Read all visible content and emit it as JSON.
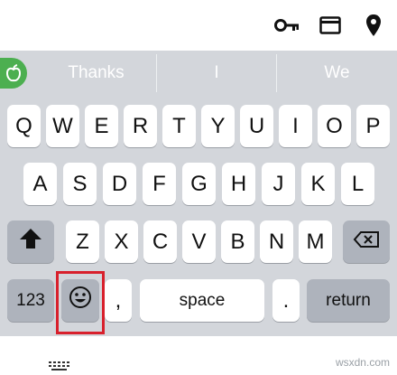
{
  "toolbar": {
    "icons": [
      "key-icon",
      "card-icon",
      "location-pin-icon"
    ]
  },
  "suggestions": {
    "logo_icon": "apple-logo-icon",
    "items": [
      "Thanks",
      "I",
      "We"
    ]
  },
  "keyboard": {
    "row1": [
      "Q",
      "W",
      "E",
      "R",
      "T",
      "Y",
      "U",
      "I",
      "O",
      "P"
    ],
    "row2": [
      "A",
      "S",
      "D",
      "F",
      "G",
      "H",
      "J",
      "K",
      "L"
    ],
    "row3": [
      "Z",
      "X",
      "C",
      "V",
      "B",
      "N",
      "M"
    ],
    "shift_icon": "shift-arrow-icon",
    "backspace_icon": "backspace-icon",
    "numbers_label": "123",
    "emoji_icon": "emoji-icon",
    "comma_label": ",",
    "space_label": "space",
    "period_label": ".",
    "return_label": "return",
    "highlight_color": "#d8202c"
  },
  "bottom": {
    "keyboard_switch_icon": "keyboard-icon",
    "watermark": "wsxdn.com"
  },
  "colors": {
    "keyboard_bg": "#d3d6db",
    "key_bg": "#ffffff",
    "function_key_bg": "#aeb3bc",
    "logo_green": "#4caf50"
  }
}
